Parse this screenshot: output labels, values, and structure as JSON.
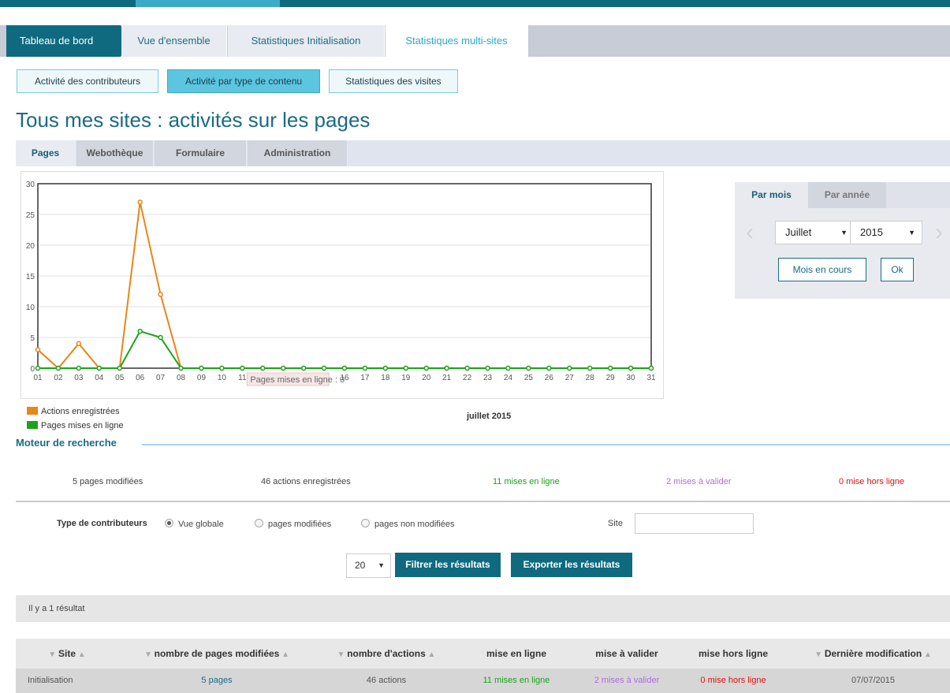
{
  "main_nav": {
    "dashboard": "Tableau de bord",
    "overview": "Vue d'ensemble",
    "stats_init": "Statistiques Initialisation",
    "stats_multi": "Statistiques multi-sites"
  },
  "sub_nav": {
    "contrib": "Activité des contributeurs",
    "content_type": "Activité par type de contenu",
    "visits": "Statistiques des visites"
  },
  "page_title": "Tous mes sites : activités sur les pages",
  "content_tabs": [
    "Pages",
    "Webothèque",
    "Formulaire",
    "Administration"
  ],
  "chart_data": {
    "type": "line",
    "categories": [
      "01",
      "02",
      "03",
      "04",
      "05",
      "06",
      "07",
      "08",
      "09",
      "10",
      "11",
      "12",
      "13",
      "14",
      "15",
      "16",
      "17",
      "18",
      "19",
      "20",
      "21",
      "22",
      "23",
      "24",
      "25",
      "26",
      "27",
      "28",
      "29",
      "30",
      "31"
    ],
    "series": [
      {
        "name": "Actions enregistrées",
        "color": "#e8861a",
        "values": [
          3,
          0,
          4,
          0,
          0,
          27,
          12,
          0,
          0,
          0,
          0,
          0,
          0,
          0,
          0,
          0,
          0,
          0,
          0,
          0,
          0,
          0,
          0,
          0,
          0,
          0,
          0,
          0,
          0,
          0,
          0
        ]
      },
      {
        "name": "Pages mises en ligne",
        "color": "#1aa31a",
        "values": [
          0,
          0,
          0,
          0,
          0,
          6,
          5,
          0,
          0,
          0,
          0,
          0,
          0,
          0,
          0,
          0,
          0,
          0,
          0,
          0,
          0,
          0,
          0,
          0,
          0,
          0,
          0,
          0,
          0,
          0,
          0
        ]
      }
    ],
    "yticks": [
      "0",
      "5",
      "10",
      "15",
      "20",
      "25",
      "30"
    ],
    "ylim": [
      0,
      30
    ],
    "xlabel": "juillet 2015",
    "tooltip": "Pages mises en ligne : 0"
  },
  "period": {
    "tab_month": "Par mois",
    "tab_year": "Par année",
    "month": "Juillet",
    "year": "2015",
    "current_month_btn": "Mois en cours",
    "ok_btn": "Ok"
  },
  "search": {
    "title": "Moteur de recherche",
    "stats": {
      "modified": "5 pages modifiées",
      "actions": "46 actions enregistrées",
      "online": "11 mises en ligne",
      "to_validate": "2 mises à valider",
      "offline": "0 mise hors ligne"
    },
    "contrib_label": "Type de contributeurs",
    "radio_global": "Vue globale",
    "radio_modified": "pages modifiées",
    "radio_unmodified": "pages non modifiées",
    "site_label": "Site",
    "per_page": "20",
    "filter_btn": "Filtrer les résultats",
    "export_btn": "Exporter les résultats"
  },
  "results": {
    "count_text": "Il y a 1 résultat",
    "headers": [
      "Site",
      "nombre de pages modifiées",
      "nombre d'actions",
      "mise en ligne",
      "mise à valider",
      "mise hors ligne",
      "Dernière modification"
    ],
    "row": {
      "site": "Initialisation",
      "pages": "5 pages",
      "actions": "46 actions",
      "online": "11 mises en ligne",
      "to_validate": "2 mises à valider",
      "offline": "0 mise hors ligne",
      "last_mod": "07/07/2015"
    }
  },
  "colors": {
    "primary": "#0f6a80",
    "accent": "#3eaac9",
    "online": "#1aa31a",
    "to_validate": "#b36be0",
    "offline": "#e01010"
  }
}
